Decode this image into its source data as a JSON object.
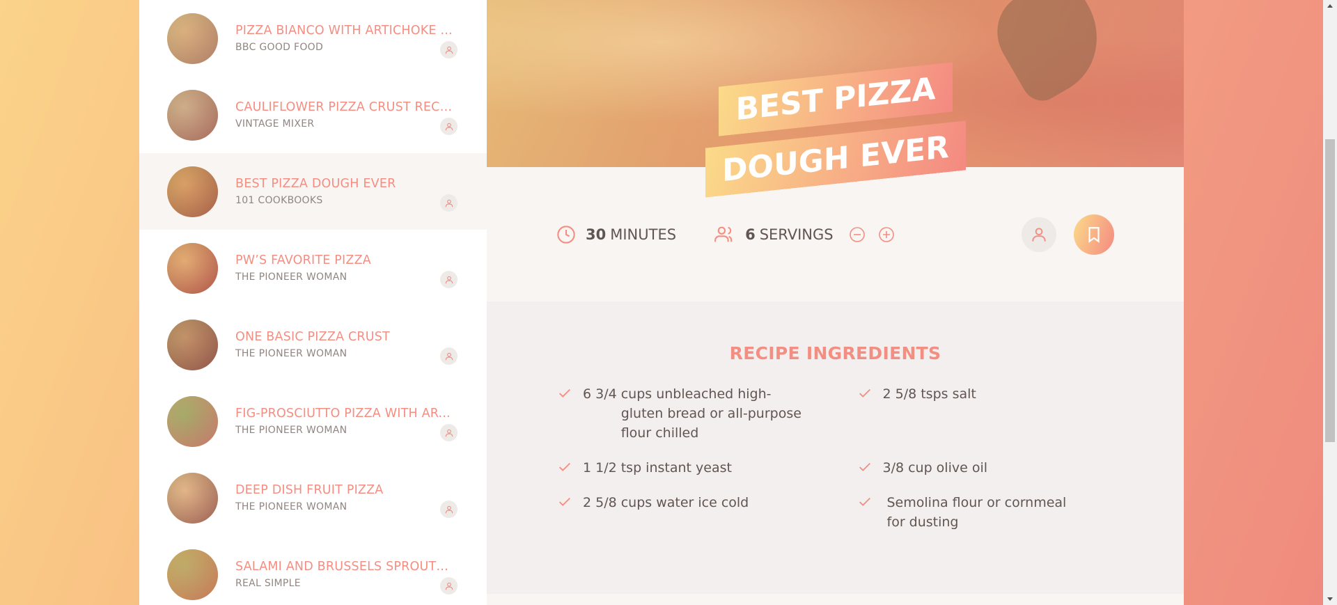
{
  "results": [
    {
      "title": "Pizza bianco with artichoke ...",
      "publisher": "BBC Good Food",
      "thumb_colors": [
        "#c9a77a",
        "#8a7a5a"
      ]
    },
    {
      "title": "Cauliflower Pizza Crust Reci...",
      "publisher": "Vintage Mixer",
      "thumb_colors": [
        "#b9a28c",
        "#7b5a48"
      ]
    },
    {
      "title": "Best Pizza Dough Ever",
      "publisher": "101 Cookbooks",
      "thumb_colors": [
        "#c78f55",
        "#7b4a2a"
      ],
      "active": true
    },
    {
      "title": "PW’s Favorite Pizza",
      "publisher": "The Pioneer Woman",
      "thumb_colors": [
        "#d7a06a",
        "#8a3a2a"
      ]
    },
    {
      "title": "One Basic Pizza Crust",
      "publisher": "The Pioneer Woman",
      "thumb_colors": [
        "#a57a5a",
        "#5a3a2a"
      ]
    },
    {
      "title": "Fig-Prosciutto Pizza with Ar...",
      "publisher": "The Pioneer Woman",
      "thumb_colors": [
        "#7aa05a",
        "#b07060"
      ]
    },
    {
      "title": "Deep Dish Fruit Pizza",
      "publisher": "The Pioneer Woman",
      "thumb_colors": [
        "#d6b08a",
        "#6a4a3a"
      ]
    },
    {
      "title": "Salami and Brussels Sprouts...",
      "publisher": "Real Simple",
      "thumb_colors": [
        "#a0a05a",
        "#b07040"
      ]
    }
  ],
  "recipe": {
    "title": "Best Pizza Dough Ever",
    "cooking_time": "30",
    "cooking_time_unit": "minutes",
    "servings": "6",
    "servings_unit": "servings",
    "ingredients_heading": "Recipe ingredients",
    "ingredients": [
      {
        "qty": "6 3/4",
        "desc": "cups unbleached high-gluten bread or all-purpose flour chilled"
      },
      {
        "qty": "2 5/8",
        "desc": "tsps salt"
      },
      {
        "qty": "1 1/2",
        "desc": "tsp instant yeast"
      },
      {
        "qty": "3/8",
        "desc": "cup olive oil"
      },
      {
        "qty": "2 5/8",
        "desc": "cups water ice cold"
      },
      {
        "qty": "",
        "desc": "Semolina flour or cornmeal for dusting"
      }
    ]
  },
  "icons": {
    "clock": "clock-icon",
    "users": "users-icon",
    "minus": "minus-circle-icon",
    "plus": "plus-circle-icon",
    "user": "user-icon",
    "bookmark": "bookmark-icon",
    "check": "check-icon"
  },
  "colors": {
    "accent": "#f38e82",
    "text": "#615551",
    "grad_start": "#fbdb89",
    "grad_end": "#f48982"
  }
}
